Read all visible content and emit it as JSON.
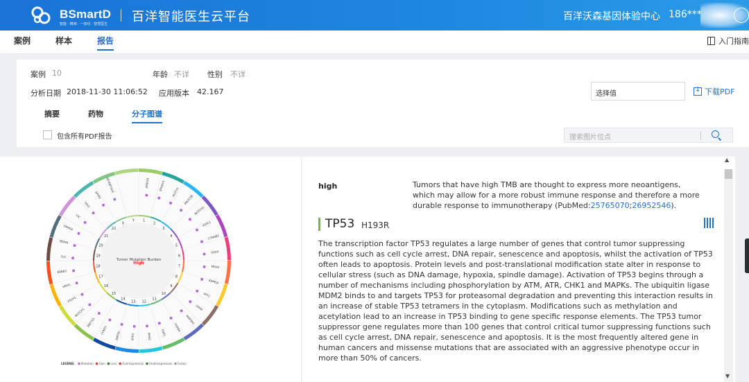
{
  "header": {
    "brand": "BSmartD",
    "brand_sub": "智能 · 精准 · 一体化 · 智慧医生",
    "platform": "百洋智能医生云平台",
    "org": "百洋沃森基因体验中心",
    "user_id": "186***"
  },
  "nav": {
    "items": [
      {
        "label": "案例"
      },
      {
        "label": "样本"
      },
      {
        "label": "报告"
      }
    ],
    "guide": "入门指南"
  },
  "case": {
    "case_label": "案例",
    "case_value": "10",
    "age_label": "年龄",
    "age_value": "不详",
    "sex_label": "性别",
    "sex_value": "不详",
    "date_label": "分析日期",
    "date_value": "2018-11-30 11:06:52",
    "version_label": "应用版本",
    "version_value": "42.167",
    "select_placeholder": "选择值",
    "download_label": "下载PDF"
  },
  "tabs": [
    {
      "label": "摘要"
    },
    {
      "label": "药物"
    },
    {
      "label": "分子图谱"
    }
  ],
  "options": {
    "include_all_pdf": "包含所有PDF报告",
    "search_placeholder": "搜索图片位点"
  },
  "circos": {
    "center_title": "Tumor Mutation Burden",
    "center_value": "High",
    "chromosomes": [
      "1",
      "2",
      "3",
      "4",
      "5",
      "6",
      "7",
      "8",
      "9",
      "10",
      "11",
      "12",
      "13",
      "14",
      "15",
      "16",
      "17",
      "18",
      "19",
      "20",
      "21",
      "22",
      "X",
      "Y"
    ],
    "genes": [
      "ARID1A",
      "EPHA10",
      "MUTYH",
      "PIK3C2B",
      "NOTCH2",
      "ASXL2",
      "CTNNB1",
      "DAXX",
      "MSH3",
      "KDM5A",
      "AFF1",
      "SDHA",
      "MAP3K1",
      "FGFR4",
      "ESR1",
      "PMS2",
      "ATRX",
      "KMT2C",
      "CCND1",
      "ZNF703",
      "NOTCH1",
      "PTCH1",
      "HRAS",
      "ERBB3",
      "FLG",
      "MDM4",
      "SMAD4",
      "CIC",
      "TP53",
      "AXIN1",
      "AR-KMT3U4"
    ],
    "legend": {
      "title": "LEGEND:",
      "items": [
        "Mutation",
        "Gain",
        "Loss",
        "Overexpression",
        "Underexpression",
        "Fusion"
      ]
    },
    "colors": {
      "ring": [
        "#9ccc65",
        "#26a69a",
        "#29b6f6",
        "#7e57c2",
        "#ab47bc",
        "#ec407a",
        "#ff7043",
        "#ffca28",
        "#8d6e63",
        "#5c6bc0",
        "#66bb6a",
        "#26c6da",
        "#1e88e5",
        "#0d47a1",
        "#8bc34a",
        "#cddc39",
        "#ffb300",
        "#f4511e",
        "#6d4c41",
        "#546e7a",
        "#ce93d8",
        "#4db6ac",
        "#81c784",
        "#aed581"
      ],
      "point": "#b36ad6",
      "center_value": "#e53935"
    }
  },
  "detail": {
    "tmb_key": "high",
    "tmb_desc": "Tumors that have high TMB are thought to express more neoantigens, which may allow for a more robust immune response and therefore a more durable response to immunotherapy (PubMed:",
    "pubmed1": "25765070",
    "pubmed_sep": ";",
    "pubmed2": "26952546",
    "tmb_end": ").",
    "gene": "TP53",
    "mutation": "H193R",
    "description": "The transcription factor TP53 regulates a large number of genes that control tumor suppressing functions such as cell cycle arrest, DNA repair, senescence and apoptosis, whilst the activation of TP53 often leads to apoptosis. Protein levels and post-translational modification state alter in response to cellular stress (such as DNA damage, hypoxia, spindle damage). Activation of TP53 begins through a number of mechanisms including phosphorylation by ATM, ATR, CHK1 and MAPKs. The ubiquitin ligase MDM2 binds to and targets TP53 for proteasomal degradation and preventing this interaction results in an increase of stable TP53 tetramers in the cytoplasm. Modifications such as methylation and acetylation lead to an increase in TP53 binding to gene specific response elements. The TP53 tumor suppressor gene regulates more than 100 genes that control critical tumor suppressing functions such as cell cycle arrest, DNA repair, senescence and apoptosis. It is the most frequently altered gene in human cancers and missense mutations that are associated with an aggressive phenotype occur in more than 50% of cancers."
  }
}
